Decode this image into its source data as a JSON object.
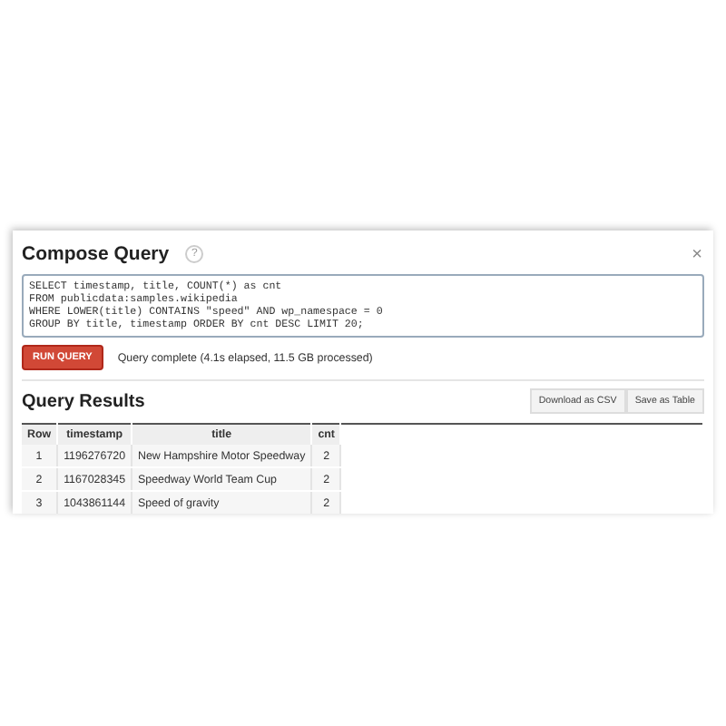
{
  "dialog": {
    "title": "Compose Query",
    "help": "?",
    "close": "×"
  },
  "query": {
    "value": "SELECT timestamp, title, COUNT(*) as cnt\nFROM publicdata:samples.wikipedia\nWHERE LOWER(title) CONTAINS \"speed\" AND wp_namespace = 0\nGROUP BY title, timestamp ORDER BY cnt DESC LIMIT 20;"
  },
  "run_button": "RUN QUERY",
  "status": "Query complete (4.1s elapsed, 11.5 GB processed)",
  "results": {
    "title": "Query Results",
    "buttons": [
      "Download as CSV",
      "Save as Table"
    ],
    "columns": [
      "Row",
      "timestamp",
      "title",
      "cnt"
    ],
    "rows": [
      [
        "1",
        "1196276720",
        "New Hampshire Motor Speedway",
        "2"
      ],
      [
        "2",
        "1167028345",
        "Speedway World Team Cup",
        "2"
      ],
      [
        "3",
        "1043861144",
        "Speed of gravity",
        "2"
      ]
    ]
  }
}
